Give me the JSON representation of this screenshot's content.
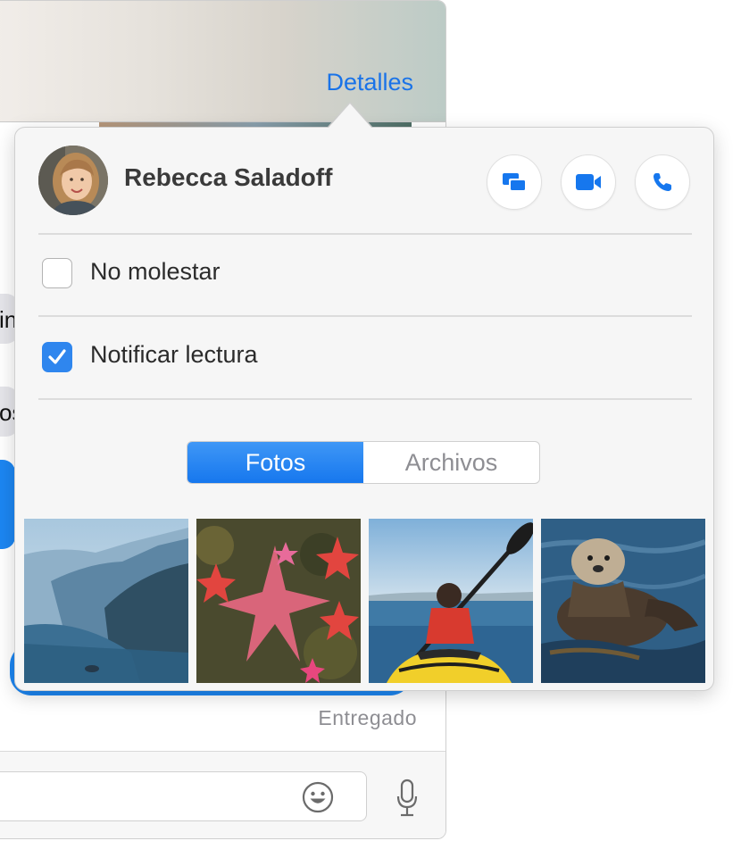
{
  "window": {
    "details_label": "Detalles",
    "bubble_text_1": "in",
    "bubble_text_2": "os",
    "status": "Entregado",
    "emoji_icon": "emoji-icon",
    "mic_icon": "microphone-icon"
  },
  "popover": {
    "contact": {
      "name": "Rebecca Saladoff",
      "actions": [
        {
          "name": "screen-share",
          "icon": "screen-share-icon"
        },
        {
          "name": "video-call",
          "icon": "video-camera-icon"
        },
        {
          "name": "audio-call",
          "icon": "phone-icon"
        }
      ]
    },
    "options": [
      {
        "label": "No molestar",
        "checked": false
      },
      {
        "label": "Notificar lectura",
        "checked": true
      }
    ],
    "tabs": [
      {
        "label": "Fotos",
        "active": true
      },
      {
        "label": "Archivos",
        "active": false
      }
    ],
    "photos": [
      {
        "subject": "coastal-cliffs"
      },
      {
        "subject": "starfish"
      },
      {
        "subject": "kayaker"
      },
      {
        "subject": "sea-otter"
      }
    ]
  },
  "colors": {
    "accent": "#1a73e8",
    "active_tab": "#1677ee",
    "checkbox_checked": "#2f86ee",
    "bubble_blue": "#1c86f2"
  }
}
